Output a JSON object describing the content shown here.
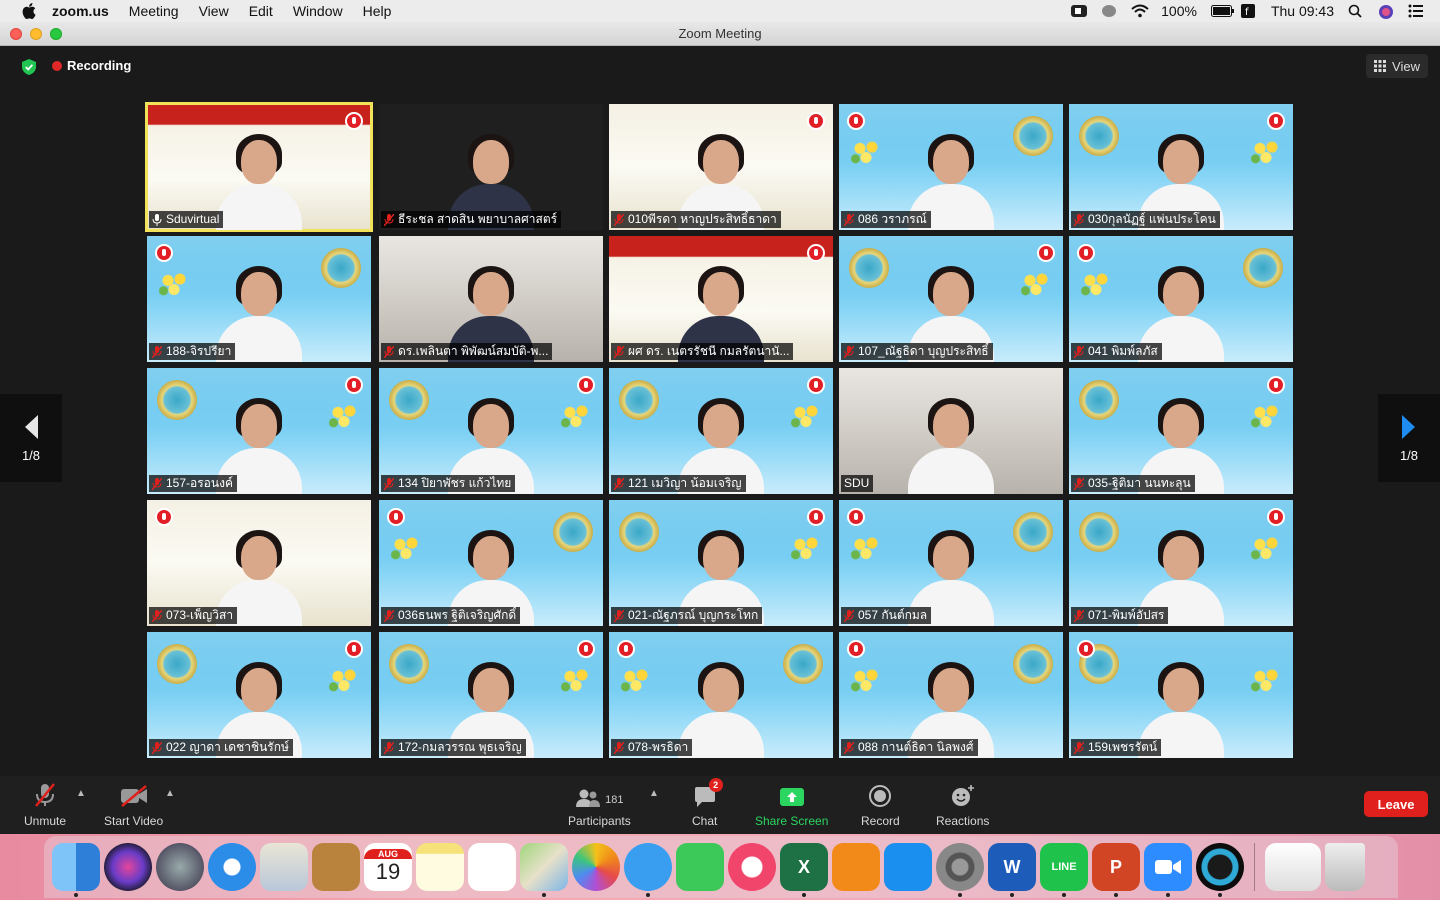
{
  "menubar": {
    "app_name": "zoom.us",
    "items": [
      "Meeting",
      "View",
      "Edit",
      "Window",
      "Help"
    ],
    "battery": "100%",
    "clock": "Thu 09:43"
  },
  "window": {
    "title": "Zoom Meeting"
  },
  "meeting": {
    "recording_label": "Recording",
    "view_label": "View",
    "page_indicator": "1/8"
  },
  "tiles": [
    {
      "name": "Sduvirtual"
    },
    {
      "name": "ธีระชล สาดสิน พยาบาลศาสตร์"
    },
    {
      "name": "010พีรดา หาญประสิทธิ์ธาดา"
    },
    {
      "name": "086 วราภรณ์"
    },
    {
      "name": "030กุลนัฏฐ์ แพ่นประโคน"
    },
    {
      "name": "188-จิรปรียา"
    },
    {
      "name": "ดร.เพลินตา พิพัฒน์สมบัติ-พ..."
    },
    {
      "name": "ผศ ดร. เนตรรัชนี กมลรัตนานั..."
    },
    {
      "name": "107_ณัฐธิดา บุญประสิทธิ์"
    },
    {
      "name": "041 พิมพ์ลภัส"
    },
    {
      "name": "157-อรอนงค์"
    },
    {
      "name": "134 ปิยาพัชร แก้วไทย"
    },
    {
      "name": "121 เมวิญา น้อมเจริญ"
    },
    {
      "name": "SDU"
    },
    {
      "name": "035-ฐิติมา นนทะลุน"
    },
    {
      "name": "073-เพ็ญวิสา"
    },
    {
      "name": "036ธนพร ฐิติเจริญศักดิ์"
    },
    {
      "name": "021-ณัฐภรณ์ บุญกระโทก"
    },
    {
      "name": "057 กันต์กมล"
    },
    {
      "name": "071-พิมพ์อัปสร"
    },
    {
      "name": "022 ญาดา เดชาชินรักษ์"
    },
    {
      "name": "172-กมลวรรณ พุธเจริญ"
    },
    {
      "name": "078-พรธิดา"
    },
    {
      "name": "088 กานต์ธิดา นิลพงศ์"
    },
    {
      "name": "159เพชรรัตน์"
    }
  ],
  "toolbar": {
    "unmute": "Unmute",
    "start_video": "Start Video",
    "participants_count": "181",
    "participants": "Participants",
    "chat": "Chat",
    "chat_badge": "2",
    "share_screen": "Share Screen",
    "record": "Record",
    "reactions": "Reactions",
    "leave": "Leave"
  },
  "dock": {
    "calendar_month": "AUG",
    "calendar_day": "19",
    "excel_letter": "X",
    "word_letter": "W",
    "powerpoint_letter": "P",
    "line_label": "LINE"
  },
  "colors": {
    "accent_green": "#2bd660",
    "leave_red": "#e0201c",
    "active_speaker": "#f2e25a"
  }
}
